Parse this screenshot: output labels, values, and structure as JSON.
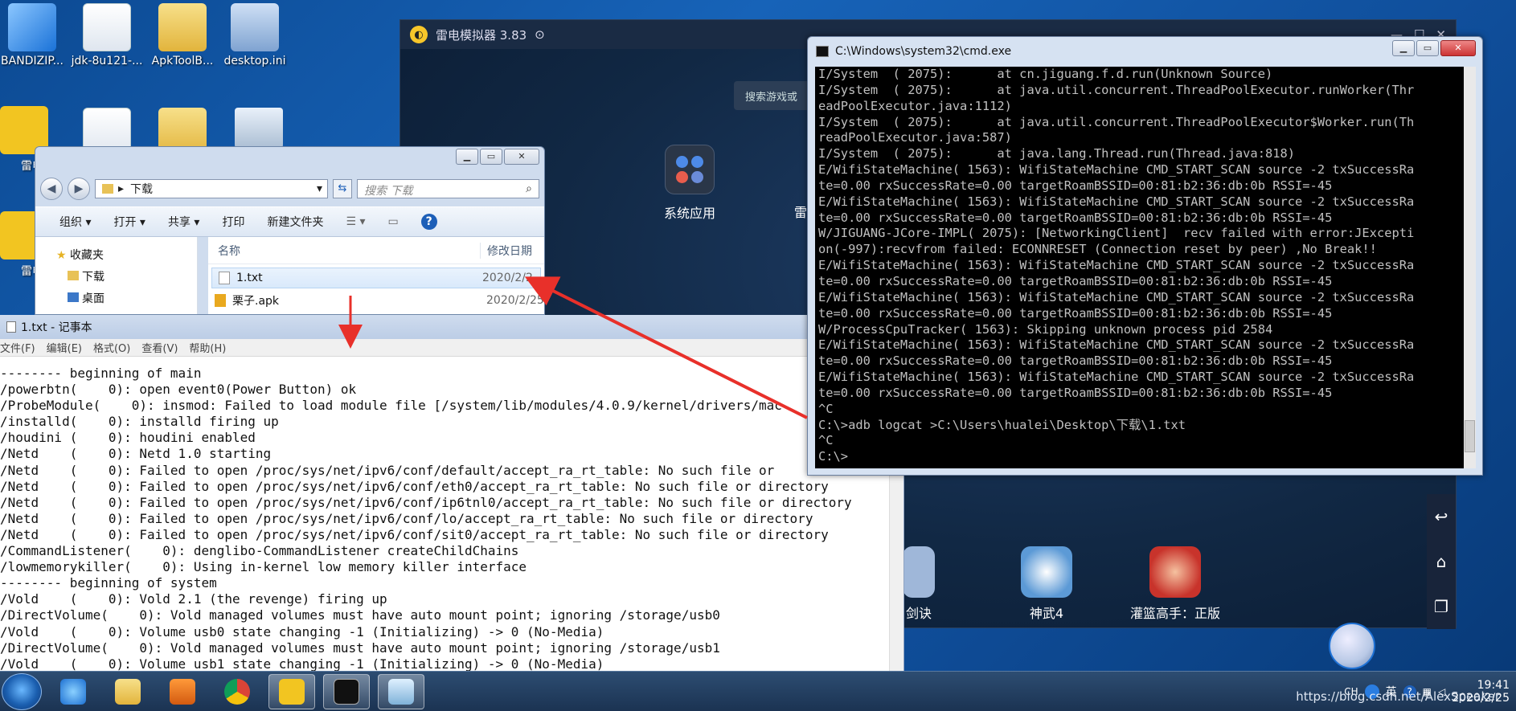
{
  "desktop": {
    "icons": [
      {
        "label": "BANDIZIP..."
      },
      {
        "label": "jdk-8u121-..."
      },
      {
        "label": "ApkToolB..."
      },
      {
        "label": "desktop.ini"
      },
      {
        "label": "雷电多"
      },
      {
        "label": "雷电模"
      }
    ]
  },
  "emulator": {
    "title": "雷电模拟器 3.83",
    "search_placeholder": "搜索游戏或",
    "system_app_label": "系统应用",
    "partial_app_label": "雷",
    "games": [
      {
        "label": "剑诀",
        "color": "#9fb7d9"
      },
      {
        "label": "神武4",
        "color": "#5c9ad6"
      },
      {
        "label": "灌篮高手：正版",
        "color": "#c8332b"
      }
    ]
  },
  "explorer": {
    "path": "下载",
    "search_placeholder": "搜索 下载",
    "toolbar": [
      "组织 ▾",
      "打开 ▾",
      "共享 ▾",
      "打印",
      "新建文件夹"
    ],
    "nav": [
      "收藏夹",
      "下载",
      "桌面"
    ],
    "columns": {
      "name": "名称",
      "date": "修改日期"
    },
    "files": [
      {
        "name": "1.txt",
        "date": "2020/2/2"
      },
      {
        "name": "栗子.apk",
        "date": "2020/2/25"
      }
    ]
  },
  "notepad": {
    "title": "1.txt - 记事本",
    "menu": [
      "文件(F)",
      "编辑(E)",
      "格式(O)",
      "查看(V)",
      "帮助(H)"
    ],
    "lines": [
      "-------- beginning of main",
      "/powerbtn(    0): open event0(Power Button) ok",
      "/ProbeModule(    0): insmod: Failed to load module file [/system/lib/modules/4.0.9/kernel/drivers/mac",
      "/installd(    0): installd firing up",
      "/houdini (    0): houdini enabled",
      "/Netd    (    0): Netd 1.0 starting",
      "/Netd    (    0): Failed to open /proc/sys/net/ipv6/conf/default/accept_ra_rt_table: No such file or",
      "/Netd    (    0): Failed to open /proc/sys/net/ipv6/conf/eth0/accept_ra_rt_table: No such file or directory",
      "/Netd    (    0): Failed to open /proc/sys/net/ipv6/conf/ip6tnl0/accept_ra_rt_table: No such file or directory",
      "/Netd    (    0): Failed to open /proc/sys/net/ipv6/conf/lo/accept_ra_rt_table: No such file or directory",
      "/Netd    (    0): Failed to open /proc/sys/net/ipv6/conf/sit0/accept_ra_rt_table: No such file or directory",
      "/CommandListener(    0): denglibo-CommandListener createChildChains",
      "/lowmemorykiller(    0): Using in-kernel low memory killer interface",
      "-------- beginning of system",
      "/Vold    (    0): Vold 2.1 (the revenge) firing up",
      "/DirectVolume(    0): Vold managed volumes must have auto mount point; ignoring /storage/usb0",
      "/Vold    (    0): Volume usb0 state changing -1 (Initializing) -> 0 (No-Media)",
      "/DirectVolume(    0): Vold managed volumes must have auto mount point; ignoring /storage/usb1",
      "/Vold    (    0): Volume usb1 state changing -1 (Initializing) -> 0 (No-Media)"
    ]
  },
  "cmd": {
    "title": "C:\\Windows\\system32\\cmd.exe",
    "lines": [
      "I/System  ( 2075):      at cn.jiguang.f.d.run(Unknown Source)",
      "I/System  ( 2075):      at java.util.concurrent.ThreadPoolExecutor.runWorker(Thr",
      "eadPoolExecutor.java:1112)",
      "I/System  ( 2075):      at java.util.concurrent.ThreadPoolExecutor$Worker.run(Th",
      "readPoolExecutor.java:587)",
      "I/System  ( 2075):      at java.lang.Thread.run(Thread.java:818)",
      "E/WifiStateMachine( 1563): WifiStateMachine CMD_START_SCAN source -2 txSuccessRa",
      "te=0.00 rxSuccessRate=0.00 targetRoamBSSID=00:81:b2:36:db:0b RSSI=-45",
      "E/WifiStateMachine( 1563): WifiStateMachine CMD_START_SCAN source -2 txSuccessRa",
      "te=0.00 rxSuccessRate=0.00 targetRoamBSSID=00:81:b2:36:db:0b RSSI=-45",
      "W/JIGUANG-JCore-IMPL( 2075): [NetworkingClient]  recv failed with error:JExcepti",
      "on(-997):recvfrom failed: ECONNRESET (Connection reset by peer) ,No Break!!",
      "E/WifiStateMachine( 1563): WifiStateMachine CMD_START_SCAN source -2 txSuccessRa",
      "te=0.00 rxSuccessRate=0.00 targetRoamBSSID=00:81:b2:36:db:0b RSSI=-45",
      "E/WifiStateMachine( 1563): WifiStateMachine CMD_START_SCAN source -2 txSuccessRa",
      "te=0.00 rxSuccessRate=0.00 targetRoamBSSID=00:81:b2:36:db:0b RSSI=-45",
      "W/ProcessCpuTracker( 1563): Skipping unknown process pid 2584",
      "E/WifiStateMachine( 1563): WifiStateMachine CMD_START_SCAN source -2 txSuccessRa",
      "te=0.00 rxSuccessRate=0.00 targetRoamBSSID=00:81:b2:36:db:0b RSSI=-45",
      "E/WifiStateMachine( 1563): WifiStateMachine CMD_START_SCAN source -2 txSuccessRa",
      "te=0.00 rxSuccessRate=0.00 targetRoamBSSID=00:81:b2:36:db:0b RSSI=-45",
      "^C",
      "C:\\>adb logcat >C:\\Users\\hualei\\Desktop\\下载\\1.txt",
      "^C",
      "C:\\>"
    ]
  },
  "taskbar": {
    "ime": "CH",
    "ime2": "英",
    "time": "19:41",
    "date": "2020/2/25",
    "watermark": "https://blog.csdn.net/AlexSpeaker"
  }
}
